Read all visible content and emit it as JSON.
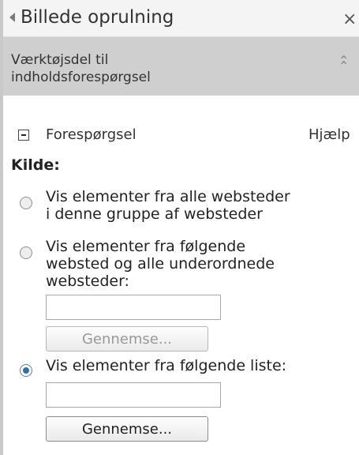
{
  "header": {
    "title": "Billede oprulning",
    "close_glyph": "×",
    "collapse_icon": "triangle-left-icon"
  },
  "section": {
    "label_line1": "Værktøjsdel til",
    "label_line2": "indholdsforespørgsel",
    "chevron_glyph": "⌃"
  },
  "query_group": {
    "label": "Forespørgsel",
    "help": "Hjælp"
  },
  "source": {
    "heading": "Kilde:",
    "options": [
      {
        "lines": [
          "Vis elementer fra alle websteder",
          "i denne gruppe af websteder"
        ],
        "selected": false
      },
      {
        "lines": [
          "Vis elementer fra følgende",
          "websted og alle underordnede",
          "websteder:"
        ],
        "selected": false,
        "input_value": "",
        "browse_label": "Gennemse...",
        "browse_enabled": false
      },
      {
        "lines": [
          "Vis elementer fra følgende liste:"
        ],
        "selected": true,
        "input_value": "",
        "browse_label": "Gennemse...",
        "browse_enabled": true
      }
    ]
  },
  "colors": {
    "section_bar": "#cfcfcf",
    "radio_selected": "#2f6bc4"
  }
}
